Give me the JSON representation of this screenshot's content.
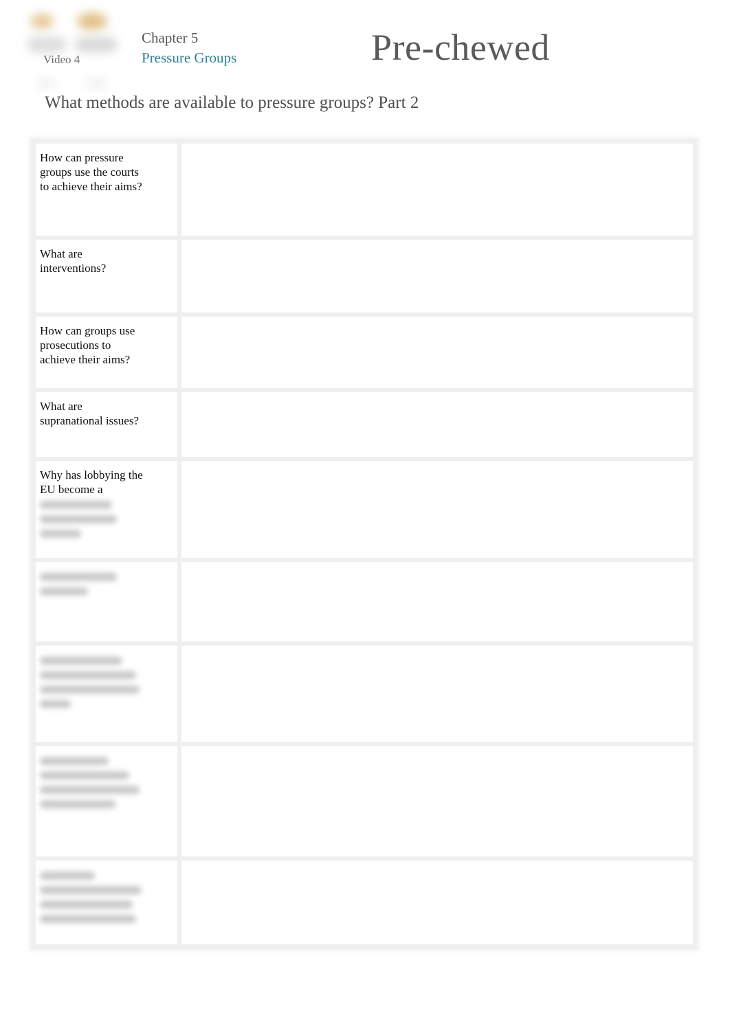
{
  "header": {
    "logo_icon": "coffee-cups-logo-icon",
    "video_label": "Video 4",
    "chapter": "Chapter 5",
    "topic": "Pressure Groups",
    "brand": "Pre-chewed",
    "subtitle": "What methods are available to pressure groups? Part 2"
  },
  "colors": {
    "topic": "#2e8296",
    "brand": "#5a5a5a",
    "chapter": "#555555",
    "border": "#efefef"
  },
  "worksheet": {
    "rows": [
      {
        "question": "How can pressure groups use the courts to achieve their aims?",
        "answer": "",
        "blurred": false
      },
      {
        "question": "What are interventions?",
        "answer": "",
        "blurred": false
      },
      {
        "question": "How can groups use prosecutions to achieve their aims?",
        "answer": "",
        "blurred": false
      },
      {
        "question": "What are supranational issues?",
        "answer": "",
        "blurred": false
      },
      {
        "question": "Why has lobbying the EU become a",
        "answer": "",
        "blurred": "partial",
        "blurred_lines": 3
      },
      {
        "question": "",
        "answer": "",
        "blurred": true,
        "blurred_lines": 2
      },
      {
        "question": "",
        "answer": "",
        "blurred": true,
        "blurred_lines": 4
      },
      {
        "question": "",
        "answer": "",
        "blurred": true,
        "blurred_lines": 4
      },
      {
        "question": "",
        "answer": "",
        "blurred": true,
        "blurred_lines": 4
      }
    ]
  }
}
